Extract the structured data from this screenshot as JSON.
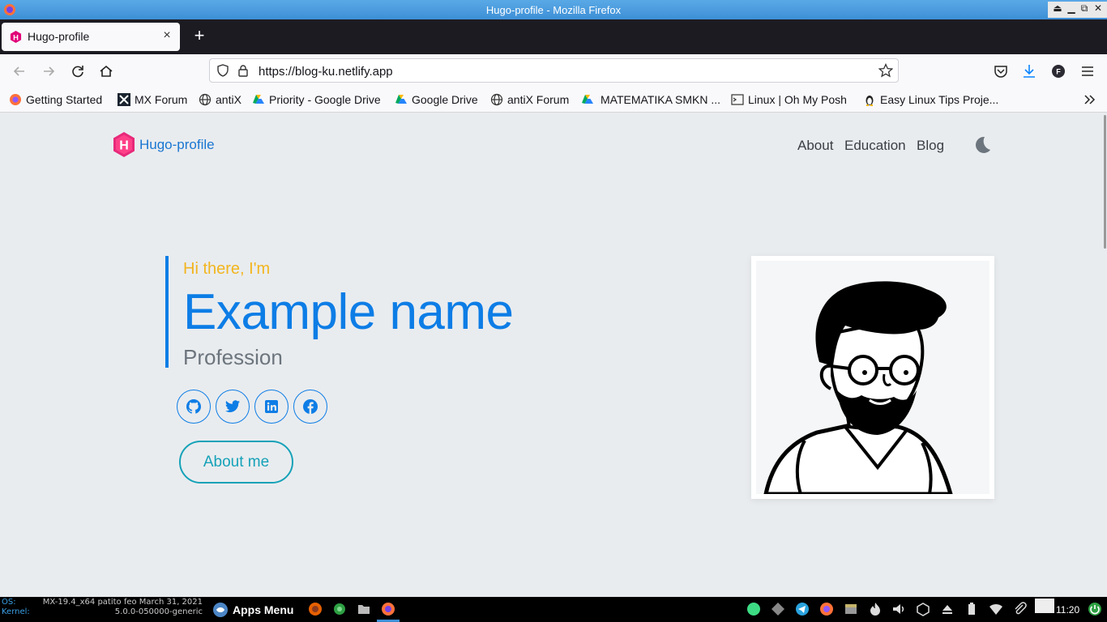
{
  "window": {
    "title": "Hugo-profile - Mozilla Firefox"
  },
  "tab": {
    "label": "Hugo-profile",
    "close": "×",
    "new_tab": "+"
  },
  "urlbar": {
    "url": "https://blog-ku.netlify.app"
  },
  "bookmarks": [
    {
      "label": "Getting Started",
      "icon": "firefox-icon"
    },
    {
      "label": "MX Forum",
      "icon": "mx-icon"
    },
    {
      "label": "antiX",
      "icon": "globe-icon"
    },
    {
      "label": "Priority - Google Drive",
      "icon": "google-drive-icon"
    },
    {
      "label": "Google Drive",
      "icon": "google-drive-icon"
    },
    {
      "label": "antiX Forum",
      "icon": "globe-icon"
    },
    {
      "label": "MATEMATIKA SMKN ...",
      "icon": "google-drive-icon"
    },
    {
      "label": "Linux | Oh My Posh",
      "icon": "terminal-icon"
    },
    {
      "label": "Easy Linux Tips Proje...",
      "icon": "tux-icon"
    }
  ],
  "site": {
    "brand": "Hugo-profile",
    "nav": {
      "about": "About",
      "education": "Education",
      "blog": "Blog"
    },
    "hero": {
      "greeting": "Hi there, I'm",
      "name": "Example name",
      "profession": "Profession",
      "about_button": "About me"
    },
    "social": [
      "github-icon",
      "twitter-icon",
      "linkedin-icon",
      "facebook-icon"
    ],
    "colors": {
      "primary": "#0d7de6",
      "greeting": "#f2b51e",
      "button": "#15a2b8",
      "background": "#e9ecef"
    }
  },
  "taskbar": {
    "os_key": "OS:",
    "os_value": "MX-19.4_x64 patito feo March 31, 2021",
    "kernel_key": "Kernel:",
    "kernel_value": "5.0.0-050000-generic",
    "apps_menu": "Apps Menu",
    "clock": "11:20"
  }
}
